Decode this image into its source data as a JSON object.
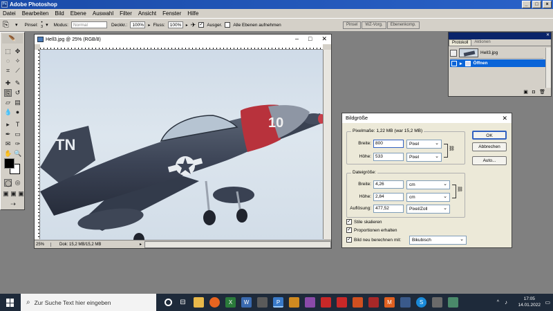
{
  "window": {
    "title": "Adobe Photoshop"
  },
  "menu": [
    "Datei",
    "Bearbeiten",
    "Bild",
    "Ebene",
    "Auswahl",
    "Filter",
    "Ansicht",
    "Fenster",
    "Hilfe"
  ],
  "options": {
    "pinsel_label": "Pinsel:",
    "pinsel_size": "3",
    "modus_label": "Modus:",
    "modus_value": "Normal",
    "deckkraft_label": "Deckkr.:",
    "deckkraft_value": "100%",
    "fluss_label": "Fluss:",
    "fluss_value": "100%",
    "ausger_label": "Ausger.",
    "alle_ebenen_label": "Alle Ebenen aufnehmen"
  },
  "palette_well": [
    "Pinsel",
    "WZ-Vorg.",
    "Ebenenkomp."
  ],
  "document": {
    "title": "Hell3.jpg @ 25% (RGB/8)",
    "zoom": "25%",
    "doc_info": "Dok: 15,2 MB/15,2 MB",
    "plane_text": "10",
    "plane_tail": "TN"
  },
  "history": {
    "tabs": [
      "Protokoll",
      "Aktionen"
    ],
    "snapshot": "Hell3.jpg",
    "step": "Öffnen"
  },
  "dialog": {
    "title": "Bildgröße",
    "pixel_group": "Pixelmaße: 1,22 MB (war 15,2 MB)",
    "pixel_width_label": "Breite:",
    "pixel_width": "800",
    "pixel_width_unit": "Pixel",
    "pixel_height_label": "Höhe:",
    "pixel_height": "533",
    "pixel_height_unit": "Pixel",
    "doc_group": "Dateigröße:",
    "doc_width_label": "Breite:",
    "doc_width": "4,26",
    "doc_width_unit": "cm",
    "doc_height_label": "Höhe:",
    "doc_height": "2,84",
    "doc_height_unit": "cm",
    "resolution_label": "Auflösung:",
    "resolution": "477,52",
    "resolution_unit": "Pixel/Zoll",
    "styles_label": "Stile skalieren",
    "proportions_label": "Proportionen erhalten",
    "resample_label": "Bild neu berechnen mit:",
    "resample_method": "Bikubisch",
    "ok_label": "OK",
    "cancel_label": "Abbrechen",
    "auto_label": "Auto..."
  },
  "taskbar": {
    "search_placeholder": "Zur Suche Text hier eingeben",
    "time": "17:05",
    "date": "14.01.2022"
  }
}
